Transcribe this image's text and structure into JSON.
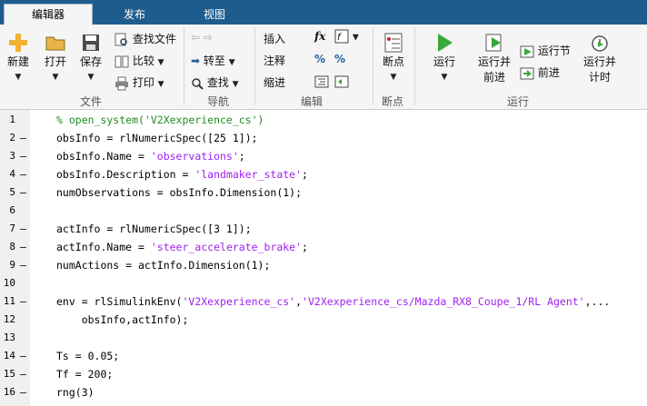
{
  "tabs": [
    "编辑器",
    "发布",
    "视图"
  ],
  "ribbon": {
    "file": {
      "new": "新建",
      "open": "打开",
      "save": "保存",
      "find_files": "查找文件",
      "compare": "比较",
      "print": "打印",
      "group": "文件"
    },
    "navigate": {
      "goto": "转至",
      "find": "查找",
      "group": "导航"
    },
    "edit": {
      "insert": "插入",
      "fx": "fx",
      "comment": "注释",
      "indent": "缩进",
      "group": "编辑"
    },
    "breakpoints": {
      "btn": "断点",
      "group": "断点"
    },
    "run": {
      "run": "运行",
      "run_advance_1": "运行并",
      "run_advance_2": "前进",
      "run_section": "运行节",
      "advance": "前进",
      "run_time_1": "运行并",
      "run_time_2": "计时",
      "group": "运行"
    }
  },
  "code_lines": [
    {
      "n": "1",
      "dash": "",
      "indent": "",
      "parts": [
        {
          "t": "% open_system('V2Xexperience_cs')",
          "c": "cmt"
        }
      ]
    },
    {
      "n": "2",
      "dash": "–",
      "indent": "",
      "parts": [
        {
          "t": "obsInfo = rlNumericSpec([25 1]);",
          "c": "kw"
        }
      ]
    },
    {
      "n": "3",
      "dash": "–",
      "indent": "",
      "parts": [
        {
          "t": "obsInfo.Name = ",
          "c": "kw"
        },
        {
          "t": "'observations'",
          "c": "str"
        },
        {
          "t": ";",
          "c": "kw"
        }
      ]
    },
    {
      "n": "4",
      "dash": "–",
      "indent": "",
      "parts": [
        {
          "t": "obsInfo.Description = ",
          "c": "kw"
        },
        {
          "t": "'landmaker_state'",
          "c": "str"
        },
        {
          "t": ";",
          "c": "kw"
        }
      ]
    },
    {
      "n": "5",
      "dash": "–",
      "indent": "",
      "parts": [
        {
          "t": "numObservations = obsInfo.Dimension(1);",
          "c": "kw"
        }
      ]
    },
    {
      "n": "6",
      "dash": "",
      "indent": "",
      "parts": []
    },
    {
      "n": "7",
      "dash": "–",
      "indent": "",
      "parts": [
        {
          "t": "actInfo = rlNumericSpec([3 1]);",
          "c": "kw"
        }
      ]
    },
    {
      "n": "8",
      "dash": "–",
      "indent": "",
      "parts": [
        {
          "t": "actInfo.Name = ",
          "c": "kw"
        },
        {
          "t": "'steer_accelerate_brake'",
          "c": "str"
        },
        {
          "t": ";",
          "c": "kw"
        }
      ]
    },
    {
      "n": "9",
      "dash": "–",
      "indent": "",
      "parts": [
        {
          "t": "numActions = actInfo.Dimension(1);",
          "c": "kw"
        }
      ]
    },
    {
      "n": "10",
      "dash": "",
      "indent": "",
      "parts": []
    },
    {
      "n": "11",
      "dash": "–",
      "indent": "",
      "parts": [
        {
          "t": "env = rlSimulinkEnv(",
          "c": "kw"
        },
        {
          "t": "'V2Xexperience_cs'",
          "c": "str"
        },
        {
          "t": ",",
          "c": "kw"
        },
        {
          "t": "'V2Xexperience_cs/Mazda_RX8_Coupe_1/RL Agent'",
          "c": "str"
        },
        {
          "t": ",...",
          "c": "kw"
        }
      ]
    },
    {
      "n": "12",
      "dash": "",
      "indent": "    ",
      "parts": [
        {
          "t": "obsInfo,actInfo);",
          "c": "kw"
        }
      ]
    },
    {
      "n": "13",
      "dash": "",
      "indent": "",
      "parts": []
    },
    {
      "n": "14",
      "dash": "–",
      "indent": "",
      "parts": [
        {
          "t": "Ts = 0.05;",
          "c": "kw"
        }
      ]
    },
    {
      "n": "15",
      "dash": "–",
      "indent": "",
      "parts": [
        {
          "t": "Tf = 200;",
          "c": "kw"
        }
      ]
    },
    {
      "n": "16",
      "dash": "–",
      "indent": "",
      "parts": [
        {
          "t": "rng(3)",
          "c": "kw"
        }
      ]
    }
  ]
}
